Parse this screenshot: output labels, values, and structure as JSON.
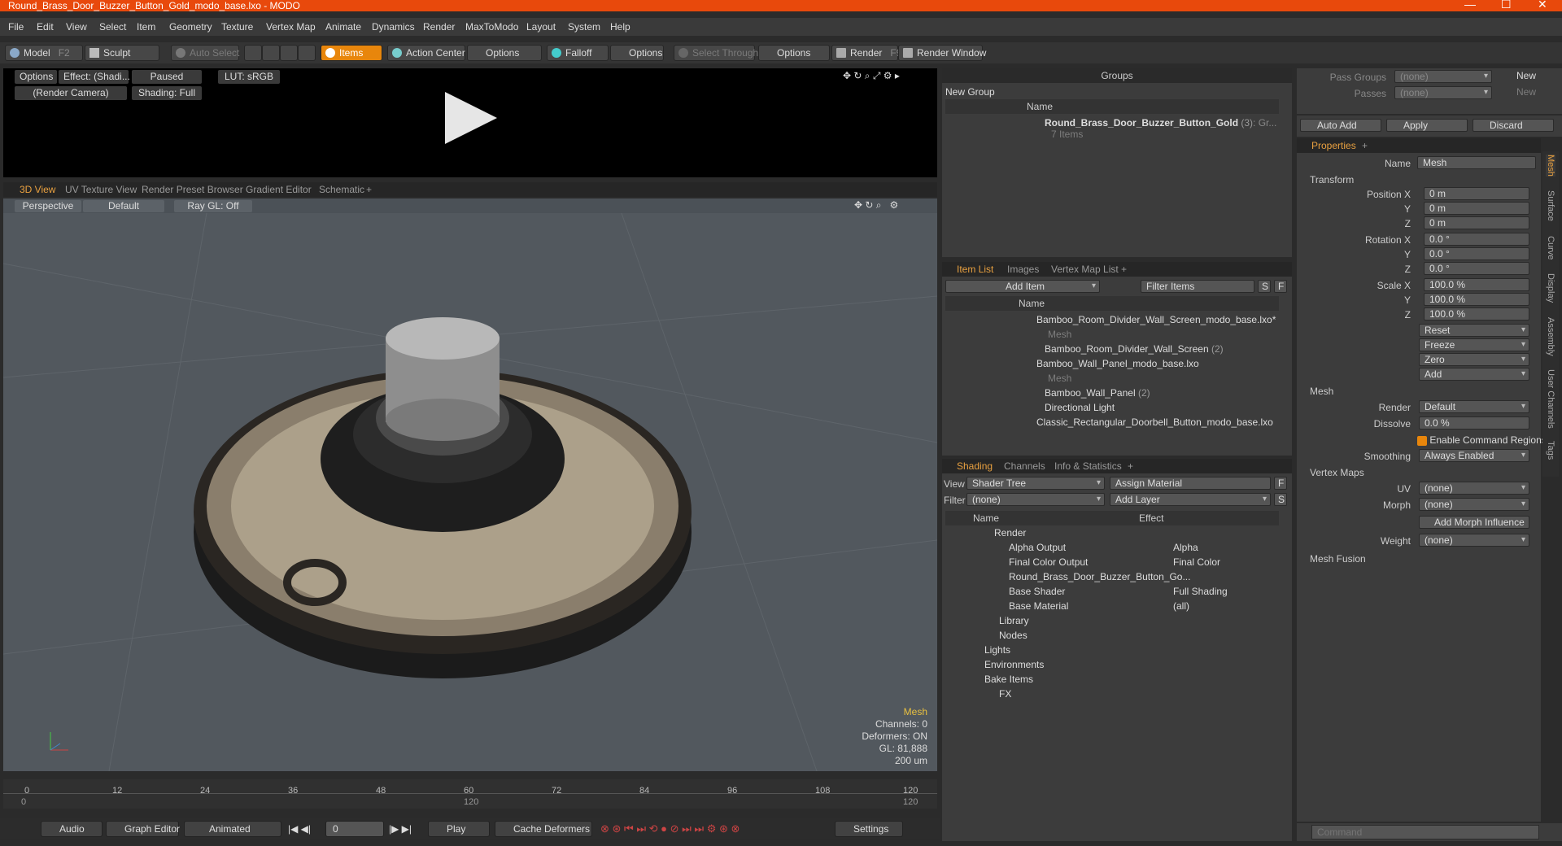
{
  "window": {
    "title": "Round_Brass_Door_Buzzer_Button_Gold_modo_base.lxo - MODO"
  },
  "menu": [
    "File",
    "Edit",
    "View",
    "Select",
    "Item",
    "Geometry",
    "Texture",
    "Vertex Map",
    "Animate",
    "Dynamics",
    "Render",
    "MaxToModo",
    "Layout",
    "System",
    "Help"
  ],
  "toolbar": {
    "model": "Model",
    "model_key": "F2",
    "sculpt": "Sculpt",
    "auto_select": "Auto Select",
    "items": "Items",
    "action_center": "Action Center",
    "options1": "Options",
    "falloff": "Falloff",
    "options2": "Options",
    "select_through": "Select Through",
    "options3": "Options",
    "render": "Render",
    "render_key": "F9",
    "render_window": "Render Window"
  },
  "preview": {
    "options": "Options",
    "effect": "Effect: (Shadi...",
    "paused": "Paused",
    "lut": "LUT: sRGB",
    "camera": "(Render Camera)",
    "shading": "Shading: Full"
  },
  "view_tabs": [
    "3D View",
    "UV Texture View",
    "Render Preset Browser",
    "Gradient Editor",
    "Schematic",
    "+"
  ],
  "viewport": {
    "perspective": "Perspective",
    "default": "Default",
    "raygl": "Ray GL: Off",
    "stats": {
      "mesh": "Mesh",
      "channels": "Channels: 0",
      "deformers": "Deformers: ON",
      "gl": "GL: 81,888",
      "scale": "200 um"
    }
  },
  "timeline": {
    "ticks": [
      "0",
      "12",
      "24",
      "36",
      "48",
      "60",
      "72",
      "84",
      "96",
      "108",
      "120"
    ],
    "start": "0",
    "mid": "120",
    "end": "120"
  },
  "bottom": {
    "audio": "Audio",
    "graph_editor": "Graph Editor",
    "animated": "Animated",
    "frame": "0",
    "play": "Play",
    "cache": "Cache Deformers",
    "settings": "Settings"
  },
  "groups": {
    "title": "Groups",
    "new_group": "New Group",
    "col_name": "Name",
    "item": "Round_Brass_Door_Buzzer_Button_Gold",
    "item_count": "(3)",
    "item_suffix": ": Gr...",
    "items_label": "7 Items"
  },
  "itemlist": {
    "tabs": [
      "Item List",
      "Images",
      "Vertex Map List",
      "+"
    ],
    "add_item": "Add Item",
    "filter": "Filter Items",
    "s": "S",
    "f": "F",
    "col_name": "Name",
    "rows": [
      {
        "label": "Bamboo_Room_Divider_Wall_Screen_modo_base.lxo*",
        "dim": false
      },
      {
        "label": "Mesh",
        "dim": true
      },
      {
        "label": "Bamboo_Room_Divider_Wall_Screen",
        "count": "(2)",
        "dim": false
      },
      {
        "label": "Bamboo_Wall_Panel_modo_base.lxo",
        "dim": false
      },
      {
        "label": "Mesh",
        "dim": true
      },
      {
        "label": "Bamboo_Wall_Panel",
        "count": "(2)",
        "dim": false
      },
      {
        "label": "Directional Light",
        "dim": false
      },
      {
        "label": "Classic_Rectangular_Doorbell_Button_modo_base.lxo",
        "dim": false
      }
    ]
  },
  "shading": {
    "tabs": [
      "Shading",
      "Channels",
      "Info & Statistics",
      "+"
    ],
    "view_label": "View",
    "view_value": "Shader Tree",
    "assign": "Assign Material",
    "f": "F",
    "filter_label": "Filter",
    "filter_value": "(none)",
    "add_layer": "Add Layer",
    "s": "S",
    "col_name": "Name",
    "col_effect": "Effect",
    "rows": [
      {
        "name": "Render",
        "effect": ""
      },
      {
        "name": "Alpha Output",
        "effect": "Alpha"
      },
      {
        "name": "Final Color Output",
        "effect": "Final Color"
      },
      {
        "name": "Round_Brass_Door_Buzzer_Button_Go...",
        "effect": ""
      },
      {
        "name": "Base Shader",
        "effect": "Full Shading"
      },
      {
        "name": "Base Material",
        "effect": "(all)"
      },
      {
        "name": "Library",
        "effect": ""
      },
      {
        "name": "Nodes",
        "effect": ""
      },
      {
        "name": "Lights",
        "effect": ""
      },
      {
        "name": "Environments",
        "effect": ""
      },
      {
        "name": "Bake Items",
        "effect": ""
      },
      {
        "name": "FX",
        "effect": ""
      }
    ]
  },
  "passes": {
    "pass_groups": "Pass Groups",
    "passes": "Passes",
    "none": "(none)",
    "new": "New",
    "auto_add": "Auto Add",
    "apply": "Apply",
    "discard": "Discard"
  },
  "properties": {
    "tab": "Properties",
    "plus": "+",
    "name_label": "Name",
    "name_value": "Mesh",
    "transform": "Transform",
    "pos_label": "Position X",
    "y": "Y",
    "z": "Z",
    "pos": [
      "0 m",
      "0 m",
      "0 m"
    ],
    "rot_label": "Rotation X",
    "rot": [
      "0.0 °",
      "0.0 °",
      "0.0 °"
    ],
    "scale_label": "Scale X",
    "scale": [
      "100.0 %",
      "100.0 %",
      "100.0 %"
    ],
    "reset": "Reset",
    "freeze": "Freeze",
    "zero": "Zero",
    "add": "Add",
    "mesh_sect": "Mesh",
    "render_label": "Render",
    "render_value": "Default",
    "dissolve_label": "Dissolve",
    "dissolve_value": "0.0 %",
    "cmd_regions": "Enable Command Regions",
    "smoothing_label": "Smoothing",
    "smoothing_value": "Always Enabled",
    "vmaps": "Vertex Maps",
    "uv_label": "UV",
    "uv_value": "(none)",
    "morph_label": "Morph",
    "morph_value": "(none)",
    "add_morph": "Add Morph Influence",
    "weight_label": "Weight",
    "weight_value": "(none)",
    "mesh_fusion": "Mesh Fusion",
    "side_tabs": [
      "Mesh",
      "Surface",
      "Curve",
      "Display",
      "Assembly",
      "User Channels",
      "Tags"
    ]
  },
  "command": {
    "placeholder": "Command"
  },
  "colors": {
    "title_bar": "#e8490c",
    "accent": "#e8860c",
    "viewport": "#52585e"
  }
}
